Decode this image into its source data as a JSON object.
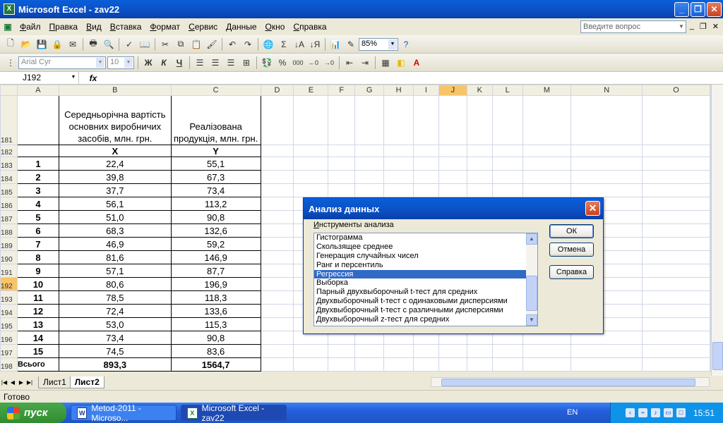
{
  "window": {
    "title": "Microsoft Excel - zav22",
    "app_icon": "excel-icon",
    "controls": [
      "minimize-icon",
      "restore-icon",
      "close-icon"
    ]
  },
  "menu": [
    "Файл",
    "Правка",
    "Вид",
    "Вставка",
    "Формат",
    "Сервис",
    "Данные",
    "Окно",
    "Справка"
  ],
  "help_search": {
    "placeholder": "Введите вопрос"
  },
  "toolbar1": {
    "zoom": "85%"
  },
  "toolbar2": {
    "font": "Arial Cyr",
    "size": "10",
    "bold": "Ж",
    "italic": "К",
    "underline": "Ч",
    "percent": "%",
    "thousands": "000"
  },
  "formula": {
    "name_box": "J192",
    "fx": "fx",
    "content": ""
  },
  "columns": [
    "A",
    "B",
    "C",
    "D",
    "E",
    "F",
    "G",
    "H",
    "I",
    "J",
    "K",
    "L",
    "M",
    "N",
    "O"
  ],
  "selected_column": "J",
  "selected_row": "192",
  "sheet": {
    "header_b": "Середньорічна вартість основних виробничих засобів, млн. грн.",
    "header_c": "Реалізована продукція, млн. грн.",
    "var_x": "X",
    "var_y": "Y",
    "rows": [
      {
        "r": "183",
        "n": "1",
        "x": "22,4",
        "y": "55,1"
      },
      {
        "r": "184",
        "n": "2",
        "x": "39,8",
        "y": "67,3"
      },
      {
        "r": "185",
        "n": "3",
        "x": "37,7",
        "y": "73,4"
      },
      {
        "r": "186",
        "n": "4",
        "x": "56,1",
        "y": "113,2"
      },
      {
        "r": "187",
        "n": "5",
        "x": "51,0",
        "y": "90,8"
      },
      {
        "r": "188",
        "n": "6",
        "x": "68,3",
        "y": "132,6"
      },
      {
        "r": "189",
        "n": "7",
        "x": "46,9",
        "y": "59,2"
      },
      {
        "r": "190",
        "n": "8",
        "x": "81,6",
        "y": "146,9"
      },
      {
        "r": "191",
        "n": "9",
        "x": "57,1",
        "y": "87,7"
      },
      {
        "r": "192",
        "n": "10",
        "x": "80,6",
        "y": "196,9"
      },
      {
        "r": "193",
        "n": "11",
        "x": "78,5",
        "y": "118,3"
      },
      {
        "r": "194",
        "n": "12",
        "x": "72,4",
        "y": "133,6"
      },
      {
        "r": "195",
        "n": "13",
        "x": "53,0",
        "y": "115,3"
      },
      {
        "r": "196",
        "n": "14",
        "x": "73,4",
        "y": "90,8"
      },
      {
        "r": "197",
        "n": "15",
        "x": "74,5",
        "y": "83,6"
      }
    ],
    "total": {
      "r": "198",
      "label": "Всього",
      "x": "893,3",
      "y": "1564,7"
    }
  },
  "sheet_tabs": {
    "tabs": [
      "Лист1",
      "Лист2"
    ],
    "active": "Лист2"
  },
  "status": "Готово",
  "dialog": {
    "title": "Анализ данных",
    "label": "Инструменты анализа",
    "items": [
      "Гистограмма",
      "Скользящее среднее",
      "Генерация случайных чисел",
      "Ранг и персентиль",
      "Регрессия",
      "Выборка",
      "Парный двухвыборочный t-тест для средних",
      "Двухвыборочный t-тест с одинаковыми дисперсиями",
      "Двухвыборочный t-тест с различными дисперсиями",
      "Двухвыборочный z-тест для средних"
    ],
    "selected": "Регрессия",
    "ok": "ОК",
    "cancel": "Отмена",
    "help": "Справка"
  },
  "taskbar": {
    "start": "пуск",
    "tasks": [
      {
        "label": "Metod-2011 - Microso...",
        "icon": "word-icon"
      },
      {
        "label": "Microsoft Excel - zav22",
        "icon": "excel-icon",
        "active": true
      }
    ],
    "lang": "EN",
    "clock": "15:51"
  }
}
